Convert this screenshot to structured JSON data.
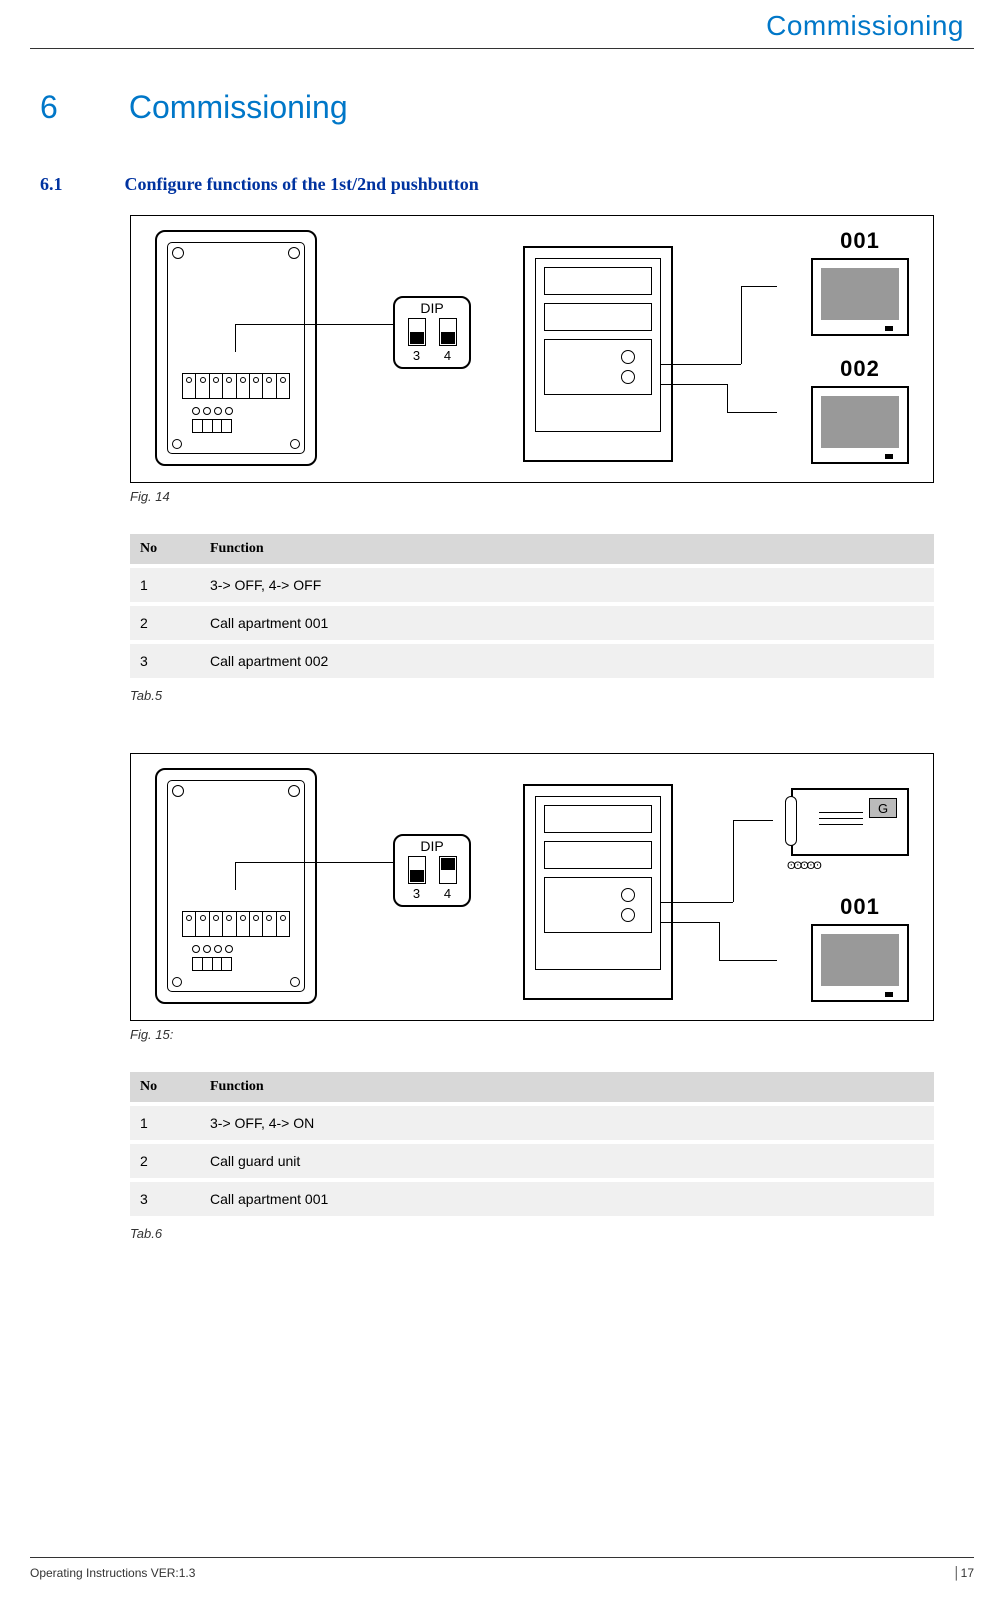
{
  "header": {
    "title": "Commissioning"
  },
  "chapter": {
    "number": "6",
    "title": "Commissioning"
  },
  "section": {
    "number": "6.1",
    "title": "Configure functions of the 1st/2nd pushbutton"
  },
  "figure1": {
    "caption": "Fig. 14",
    "dip": {
      "label": "DIP",
      "sw3": "off",
      "sw4": "off",
      "num3": "3",
      "num4": "4"
    },
    "monitor1_label": "001",
    "monitor2_label": "002"
  },
  "table1": {
    "caption": "Tab.5",
    "headers": {
      "no": "No",
      "fn": "Function"
    },
    "rows": [
      {
        "no": "1",
        "fn": "3-> OFF, 4-> OFF"
      },
      {
        "no": "2",
        "fn": "Call apartment 001"
      },
      {
        "no": "3",
        "fn": "Call apartment 002"
      }
    ]
  },
  "figure2": {
    "caption": "Fig. 15:",
    "dip": {
      "label": "DIP",
      "sw3": "off",
      "sw4": "on",
      "num3": "3",
      "num4": "4"
    },
    "guard_label": "G",
    "monitor_label": "001"
  },
  "table2": {
    "caption": "Tab.6",
    "headers": {
      "no": "No",
      "fn": "Function"
    },
    "rows": [
      {
        "no": "1",
        "fn": "3-> OFF, 4-> ON"
      },
      {
        "no": "2",
        "fn": "Call guard unit"
      },
      {
        "no": "3",
        "fn": "Call apartment 001"
      }
    ]
  },
  "footer": {
    "left": "Operating Instructions VER:1.3",
    "right": "│17"
  },
  "chart_data": [
    {
      "type": "table",
      "title": "Tab.5",
      "headers": [
        "No",
        "Function"
      ],
      "rows": [
        [
          "1",
          "3-> OFF, 4-> OFF"
        ],
        [
          "2",
          "Call apartment 001"
        ],
        [
          "3",
          "Call apartment 002"
        ]
      ]
    },
    {
      "type": "table",
      "title": "Tab.6",
      "headers": [
        "No",
        "Function"
      ],
      "rows": [
        [
          "1",
          "3-> OFF, 4-> ON"
        ],
        [
          "2",
          "Call guard unit"
        ],
        [
          "3",
          "Call apartment 001"
        ]
      ]
    }
  ]
}
